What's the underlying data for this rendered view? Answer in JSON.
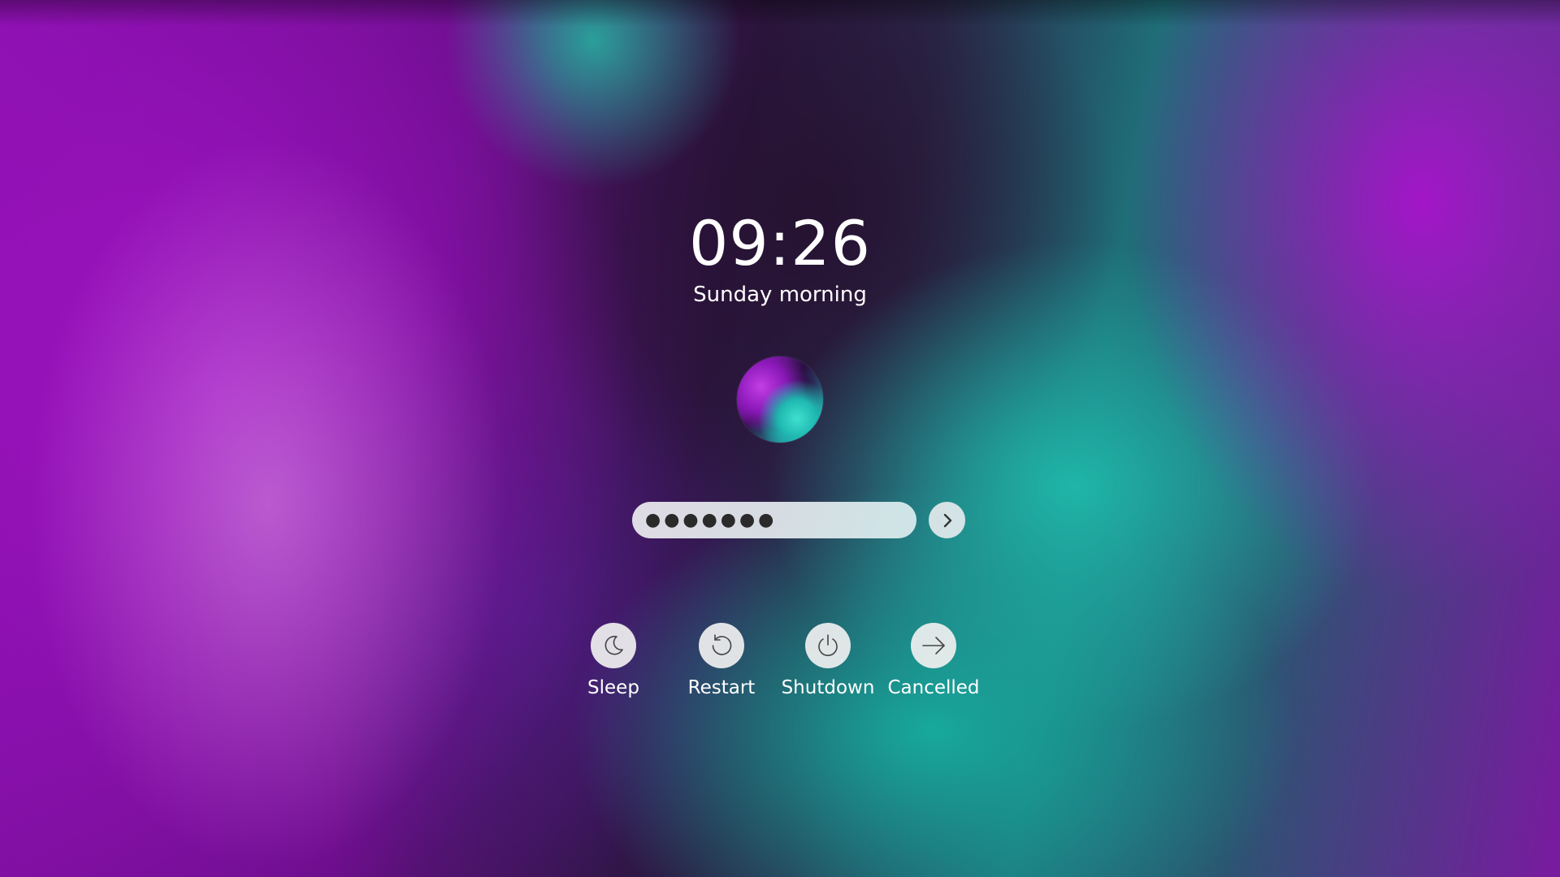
{
  "lock_screen": {
    "time": "09:26",
    "greeting": "Sunday morning"
  },
  "login": {
    "password_masked": "●●●●●●●",
    "submit_icon": "chevron-right-icon"
  },
  "actions": [
    {
      "label": "Sleep",
      "icon": "moon-icon"
    },
    {
      "label": "Restart",
      "icon": "restart-icon"
    },
    {
      "label": "Shutdown",
      "icon": "power-icon"
    },
    {
      "label": "Cancelled",
      "icon": "arrow-right-icon"
    }
  ],
  "colors": {
    "wallpaper_purple": "#a013c4",
    "wallpaper_teal": "#1fb5a8",
    "field_background": "#ececf0",
    "text": "#ffffff"
  }
}
